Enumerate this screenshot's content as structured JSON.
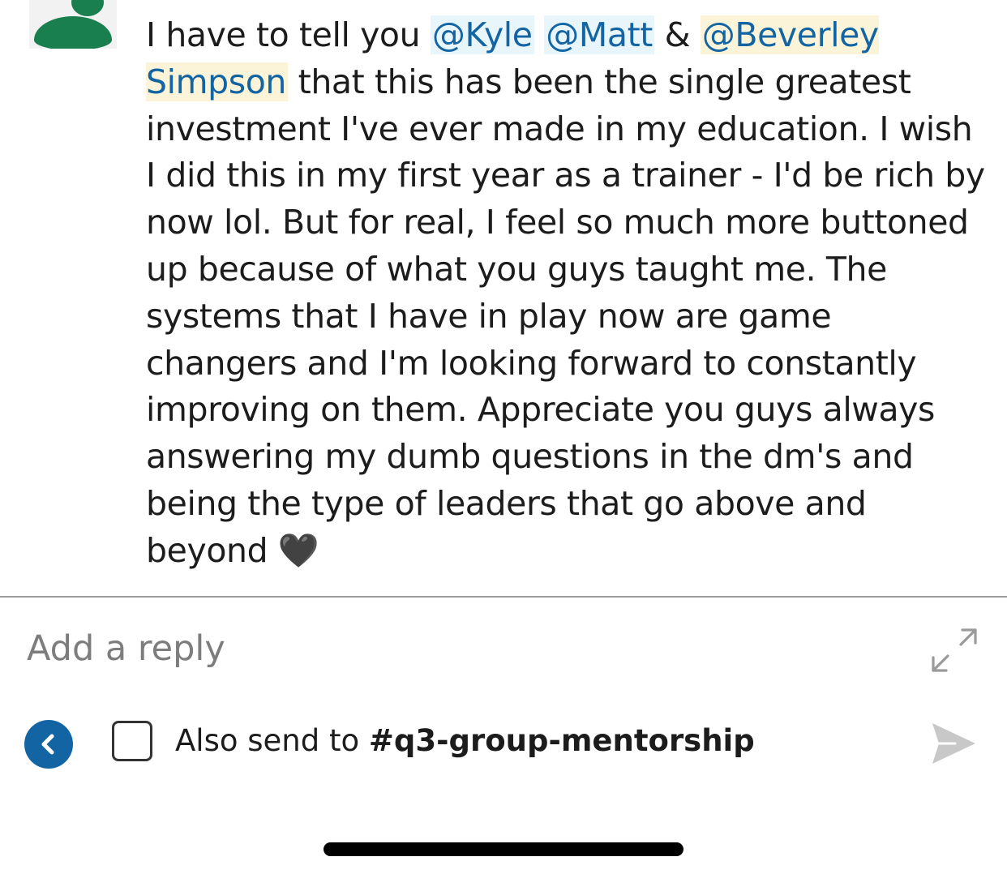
{
  "message": {
    "intro": "I have to tell you ",
    "mention_kyle": "@Kyle",
    "space1": " ",
    "mention_matt": "@Matt",
    "amp": " & ",
    "mention_beverley": "@Beverley Simpson",
    "body": " that this has been the single greatest investment I've ever made in my education. I wish I did this in my first year as a trainer - I'd be rich by now lol. But for real, I feel so much more buttoned up because of what you guys taught me. The systems that I have in play now are game changers and I'm looking forward to constantly improving on them. Appreciate you guys always answering my dumb questions in the dm's and being the type of leaders that go above and beyond ",
    "emoji": "🖤"
  },
  "composer": {
    "placeholder": "Add a reply",
    "also_send_prefix": "Also send to ",
    "channel": "#q3-group-mentorship"
  },
  "icons": {
    "avatar": "user-avatar-icon",
    "expand": "expand-icon",
    "back": "chevron-left-icon",
    "send": "send-icon"
  },
  "colors": {
    "mention_text": "#1264a3",
    "mention_bg": "#e8f5fa",
    "mention_self_bg": "#fcf4d9",
    "avatar": "#1a7f4f",
    "back_button": "#1264a3",
    "send_disabled": "#c8c8c8"
  }
}
